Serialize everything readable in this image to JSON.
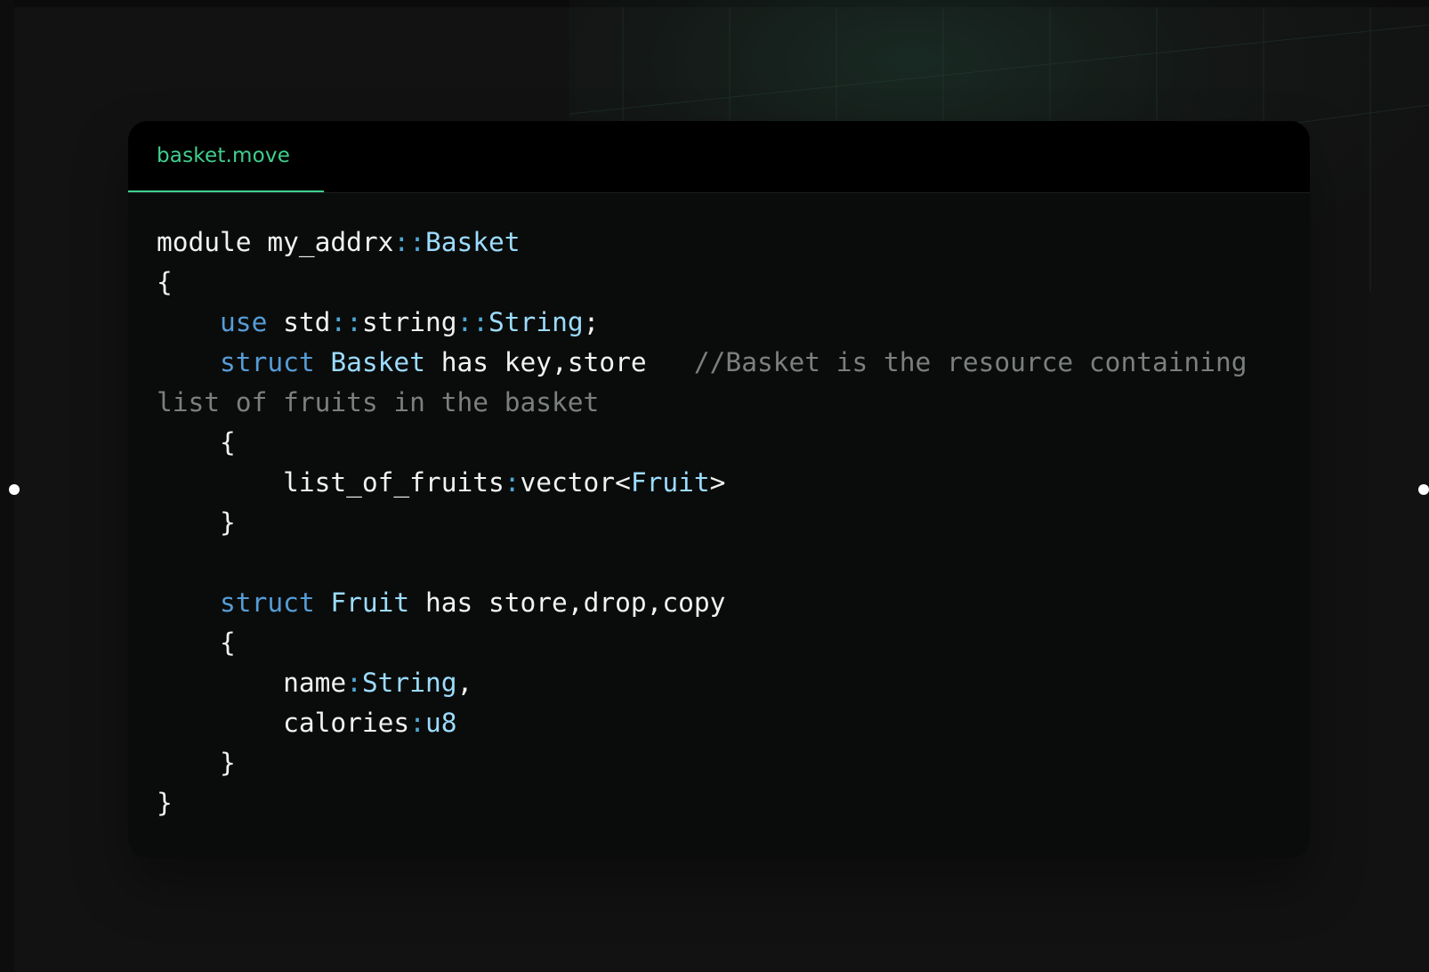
{
  "editor": {
    "tab_label": "basket.move",
    "colors": {
      "accent": "#3fcf8e",
      "keyword": "#569cd6",
      "type": "#9cdcfe",
      "comment": "#7b7f7d",
      "text": "#f2f2f2",
      "panel_background": "#0a0c0b"
    },
    "code_lines": [
      [
        {
          "t": "module my_addrx",
          "c": "pl"
        },
        {
          "t": "::",
          "c": "op"
        },
        {
          "t": "Basket",
          "c": "ty"
        }
      ],
      [
        {
          "t": "{",
          "c": "pl"
        }
      ],
      [
        {
          "t": "    ",
          "c": "pl"
        },
        {
          "t": "use",
          "c": "kw"
        },
        {
          "t": " std",
          "c": "pl"
        },
        {
          "t": "::",
          "c": "op"
        },
        {
          "t": "string",
          "c": "pl"
        },
        {
          "t": "::",
          "c": "op"
        },
        {
          "t": "String",
          "c": "ty"
        },
        {
          "t": ";",
          "c": "pl"
        }
      ],
      [
        {
          "t": "    ",
          "c": "pl"
        },
        {
          "t": "struct",
          "c": "kw"
        },
        {
          "t": " ",
          "c": "pl"
        },
        {
          "t": "Basket",
          "c": "ty"
        },
        {
          "t": " has key,store   ",
          "c": "pl"
        },
        {
          "t": "//Basket is the resource containing",
          "c": "cm"
        }
      ],
      [
        {
          "t": "list of fruits in the basket",
          "c": "cm"
        }
      ],
      [
        {
          "t": "    {",
          "c": "pl"
        }
      ],
      [
        {
          "t": "        list_of_fruits",
          "c": "pl"
        },
        {
          "t": ":",
          "c": "op"
        },
        {
          "t": "vector<",
          "c": "pl"
        },
        {
          "t": "Fruit",
          "c": "ty"
        },
        {
          "t": ">",
          "c": "pl"
        }
      ],
      [
        {
          "t": "    }",
          "c": "pl"
        }
      ],
      [
        {
          "t": "",
          "c": "pl"
        }
      ],
      [
        {
          "t": "    ",
          "c": "pl"
        },
        {
          "t": "struct",
          "c": "kw"
        },
        {
          "t": " ",
          "c": "pl"
        },
        {
          "t": "Fruit",
          "c": "ty"
        },
        {
          "t": " has store,drop,copy",
          "c": "pl"
        }
      ],
      [
        {
          "t": "    {",
          "c": "pl"
        }
      ],
      [
        {
          "t": "        name",
          "c": "pl"
        },
        {
          "t": ":",
          "c": "op"
        },
        {
          "t": "String",
          "c": "ty"
        },
        {
          "t": ",",
          "c": "pl"
        }
      ],
      [
        {
          "t": "        calories",
          "c": "pl"
        },
        {
          "t": ":",
          "c": "op"
        },
        {
          "t": "u8",
          "c": "ty"
        }
      ],
      [
        {
          "t": "    }",
          "c": "pl"
        }
      ],
      [
        {
          "t": "}",
          "c": "pl"
        }
      ]
    ]
  }
}
